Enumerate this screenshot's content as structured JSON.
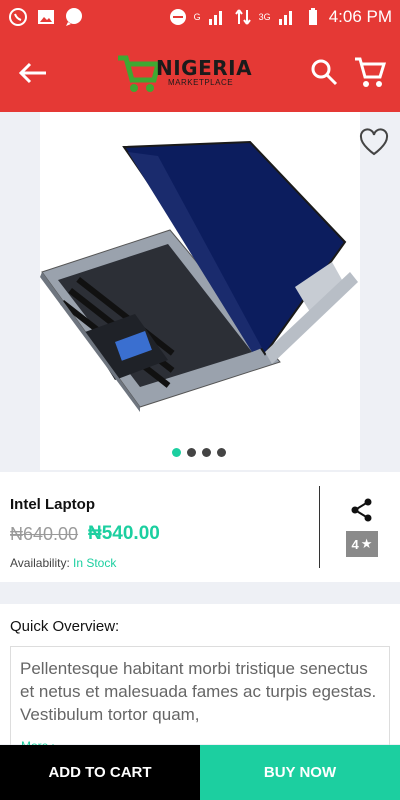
{
  "status_bar": {
    "time": "4:06 PM",
    "network_labels": [
      "G",
      "3G"
    ],
    "icons": [
      "whatsapp-icon",
      "image-icon",
      "chat-icon",
      "dnd-icon",
      "signal-icon",
      "data-transfer-icon",
      "signal-icon",
      "battery-icon"
    ]
  },
  "app_bar": {
    "logo_title": "NIGERIA",
    "logo_subtitle": "MARKETPLACE",
    "icons": [
      "back-arrow-icon",
      "cart-logo-icon",
      "search-icon",
      "shopping-cart-icon"
    ]
  },
  "gallery": {
    "image_alt": "laptop-image",
    "slide_count": 4,
    "active_slide": 1
  },
  "product": {
    "name": "Intel Laptop",
    "old_price": "₦640.00",
    "new_price": "₦540.00",
    "availability_label": "Availability:",
    "availability_value": "In Stock",
    "rating": "4"
  },
  "overview": {
    "title": "Quick Overview:",
    "text": "Pellentesque habitant morbi tristique senectus et netus et malesuada fames ac turpis egestas. Vestibulum tortor quam,",
    "more_label": "More"
  },
  "actions": {
    "add_to_cart": "ADD TO CART",
    "buy_now": "BUY NOW"
  },
  "colors": {
    "primary": "#e53935",
    "accent": "#1ccfa0",
    "black": "#000000"
  }
}
